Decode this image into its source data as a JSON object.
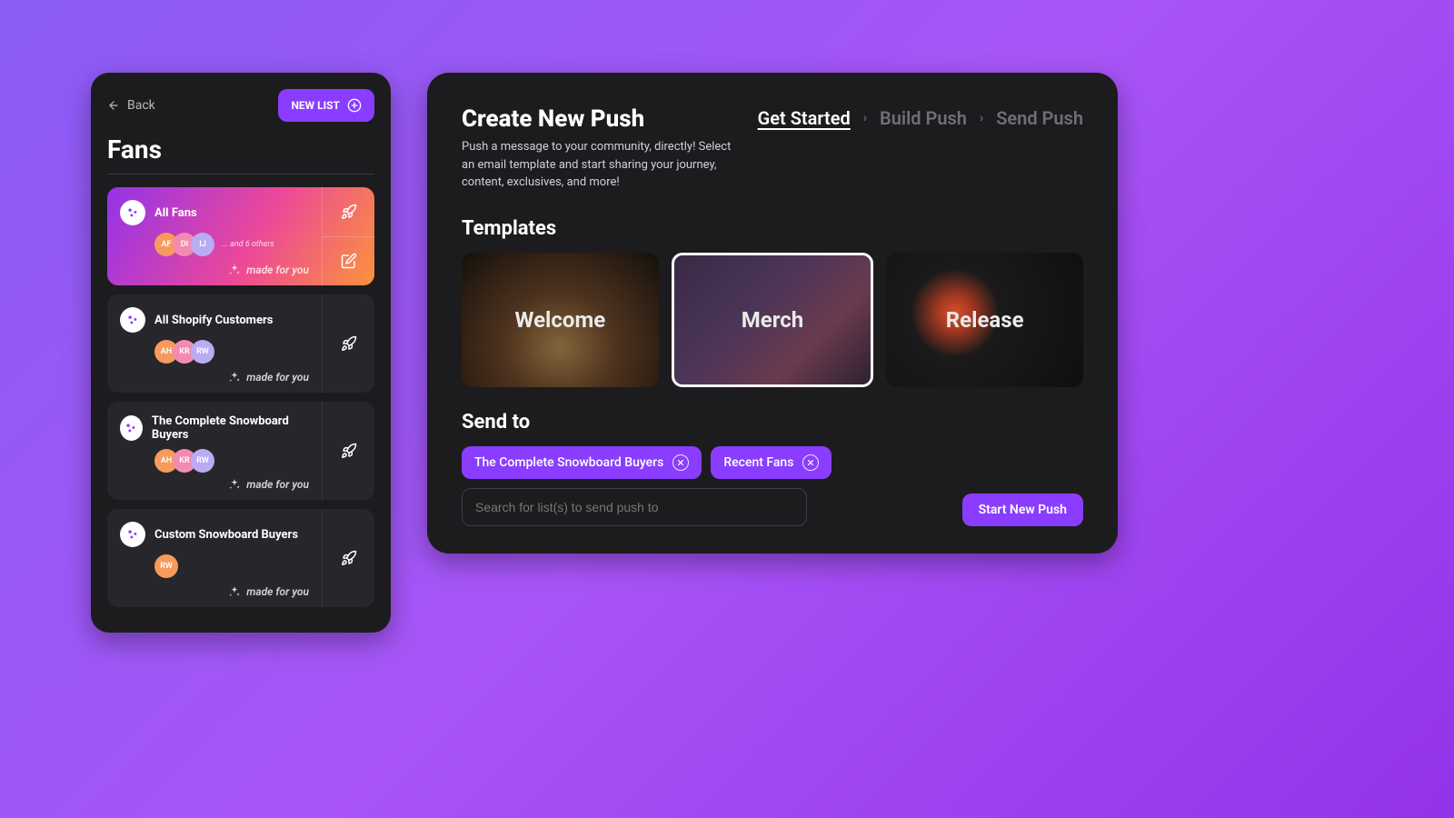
{
  "leftPanel": {
    "backLabel": "Back",
    "newListLabel": "NEW LIST",
    "title": "Fans",
    "madeForYou": "made for you",
    "othersText": "... and 6 others",
    "avatarColors": {
      "orange": "#f79a5e",
      "pink": "#f28bb2",
      "lavender": "#b9acf2"
    },
    "cards": [
      {
        "title": "All Fans",
        "avatars": [
          "AF",
          "DI",
          "IJ"
        ],
        "showOthers": true,
        "selected": true,
        "showEdit": true
      },
      {
        "title": "All Shopify Customers",
        "avatars": [
          "AH",
          "KR",
          "RW"
        ],
        "showOthers": false,
        "selected": false,
        "showEdit": false
      },
      {
        "title": "The Complete Snowboard Buyers",
        "avatars": [
          "AH",
          "KR",
          "RW"
        ],
        "showOthers": false,
        "selected": false,
        "showEdit": false
      },
      {
        "title": "Custom Snowboard Buyers",
        "avatars": [
          "RW"
        ],
        "showOthers": false,
        "selected": false,
        "showEdit": false
      }
    ]
  },
  "rightPanel": {
    "heading": "Create New Push",
    "subheading": "Push a message to your community, directly! Select an email template and start sharing your journey, content, exclusives, and more!",
    "breadcrumbs": [
      "Get Started",
      "Build Push",
      "Send Push"
    ],
    "activeCrumbIndex": 0,
    "templatesHeading": "Templates",
    "templates": [
      {
        "name": "Welcome",
        "selected": false
      },
      {
        "name": "Merch",
        "selected": true
      },
      {
        "name": "Release",
        "selected": false
      }
    ],
    "sendToHeading": "Send to",
    "chips": [
      "The Complete Snowboard Buyers",
      "Recent Fans"
    ],
    "searchPlaceholder": "Search for list(s) to send push to",
    "startButton": "Start New Push"
  },
  "colors": {
    "accent": "#8b3dff",
    "panel": "#1c1c1f",
    "card": "#27272b"
  }
}
